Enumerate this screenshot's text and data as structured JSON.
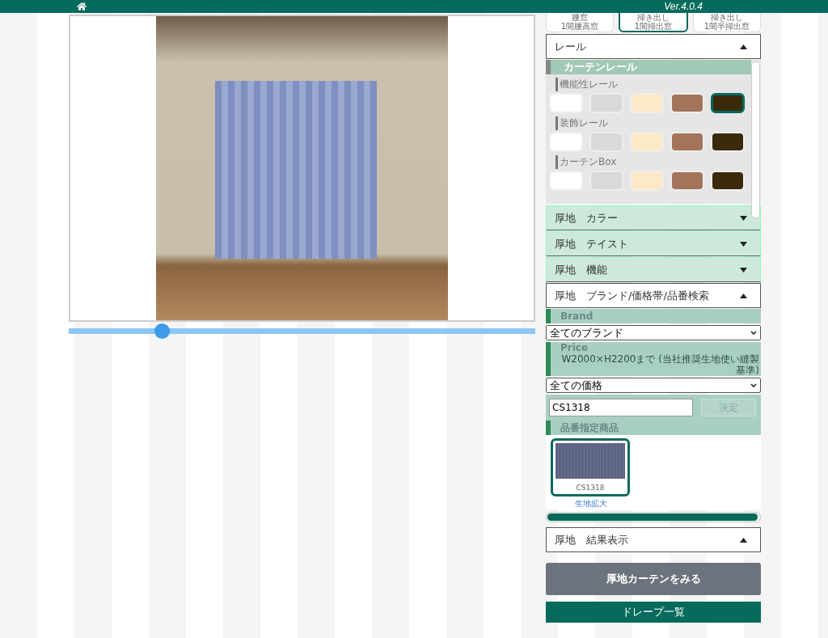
{
  "header": {
    "version": "Ver.4.0.4"
  },
  "window_types": [
    {
      "label": "腰窓",
      "sub": "1間腰高窓",
      "selected": false
    },
    {
      "label": "掃き出し",
      "sub": "1間掃出窓",
      "selected": true
    },
    {
      "label": "掃き出し",
      "sub": "1間半掃出窓",
      "selected": false
    }
  ],
  "preview": {
    "slider": {
      "level": 0.2
    }
  },
  "rail": {
    "title": "レール",
    "expanded": true,
    "subtitle": "カーテンレール",
    "groups": [
      {
        "label": "機能性レール",
        "swatches": [
          {
            "color": "#ffffff",
            "selected": false
          },
          {
            "color": "#d9d9d9",
            "selected": false
          },
          {
            "color": "#fde9c6",
            "selected": false
          },
          {
            "color": "#a3735a",
            "selected": false
          },
          {
            "color": "#3a2a0b",
            "selected": true
          }
        ]
      },
      {
        "label": "装飾レール",
        "swatches": [
          {
            "color": "#ffffff",
            "selected": false
          },
          {
            "color": "#d9d9d9",
            "selected": false
          },
          {
            "color": "#fde9c6",
            "selected": false
          },
          {
            "color": "#a3735a",
            "selected": false
          },
          {
            "color": "#3a2a0b",
            "selected": false
          }
        ]
      },
      {
        "label": "カーテンBox",
        "swatches": [
          {
            "color": "#ffffff",
            "selected": false
          },
          {
            "color": "#d9d9d9",
            "selected": false
          },
          {
            "color": "#fde9c6",
            "selected": false
          },
          {
            "color": "#a3735a",
            "selected": false
          },
          {
            "color": "#3a2a0b",
            "selected": false
          }
        ]
      }
    ]
  },
  "accordions": [
    {
      "label": "厚地　カラー",
      "expanded": false
    },
    {
      "label": "厚地　テイスト",
      "expanded": false
    },
    {
      "label": "厚地　機能",
      "expanded": false
    }
  ],
  "search": {
    "title": "厚地　ブランド/価格帯/品番検索",
    "expanded": true,
    "brand_label": "Brand",
    "brand_value": "全てのブランド",
    "price_label": "Price",
    "price_note": "W2000×H2200まで (当社推奨生地使い縫製基準)",
    "price_value": "全ての価格",
    "code_value": "CS1318",
    "decide_button": "決定",
    "products_label": "品番指定商品",
    "products": [
      {
        "code": "CS1318",
        "selected": true
      }
    ],
    "zoom_link": "生地拡大",
    "progress": {
      "level": 1
    }
  },
  "result": {
    "title": "厚地　結果表示",
    "expanded": true,
    "view_button": "厚地カーテンをみる",
    "list_button": "ドレープ一覧"
  }
}
